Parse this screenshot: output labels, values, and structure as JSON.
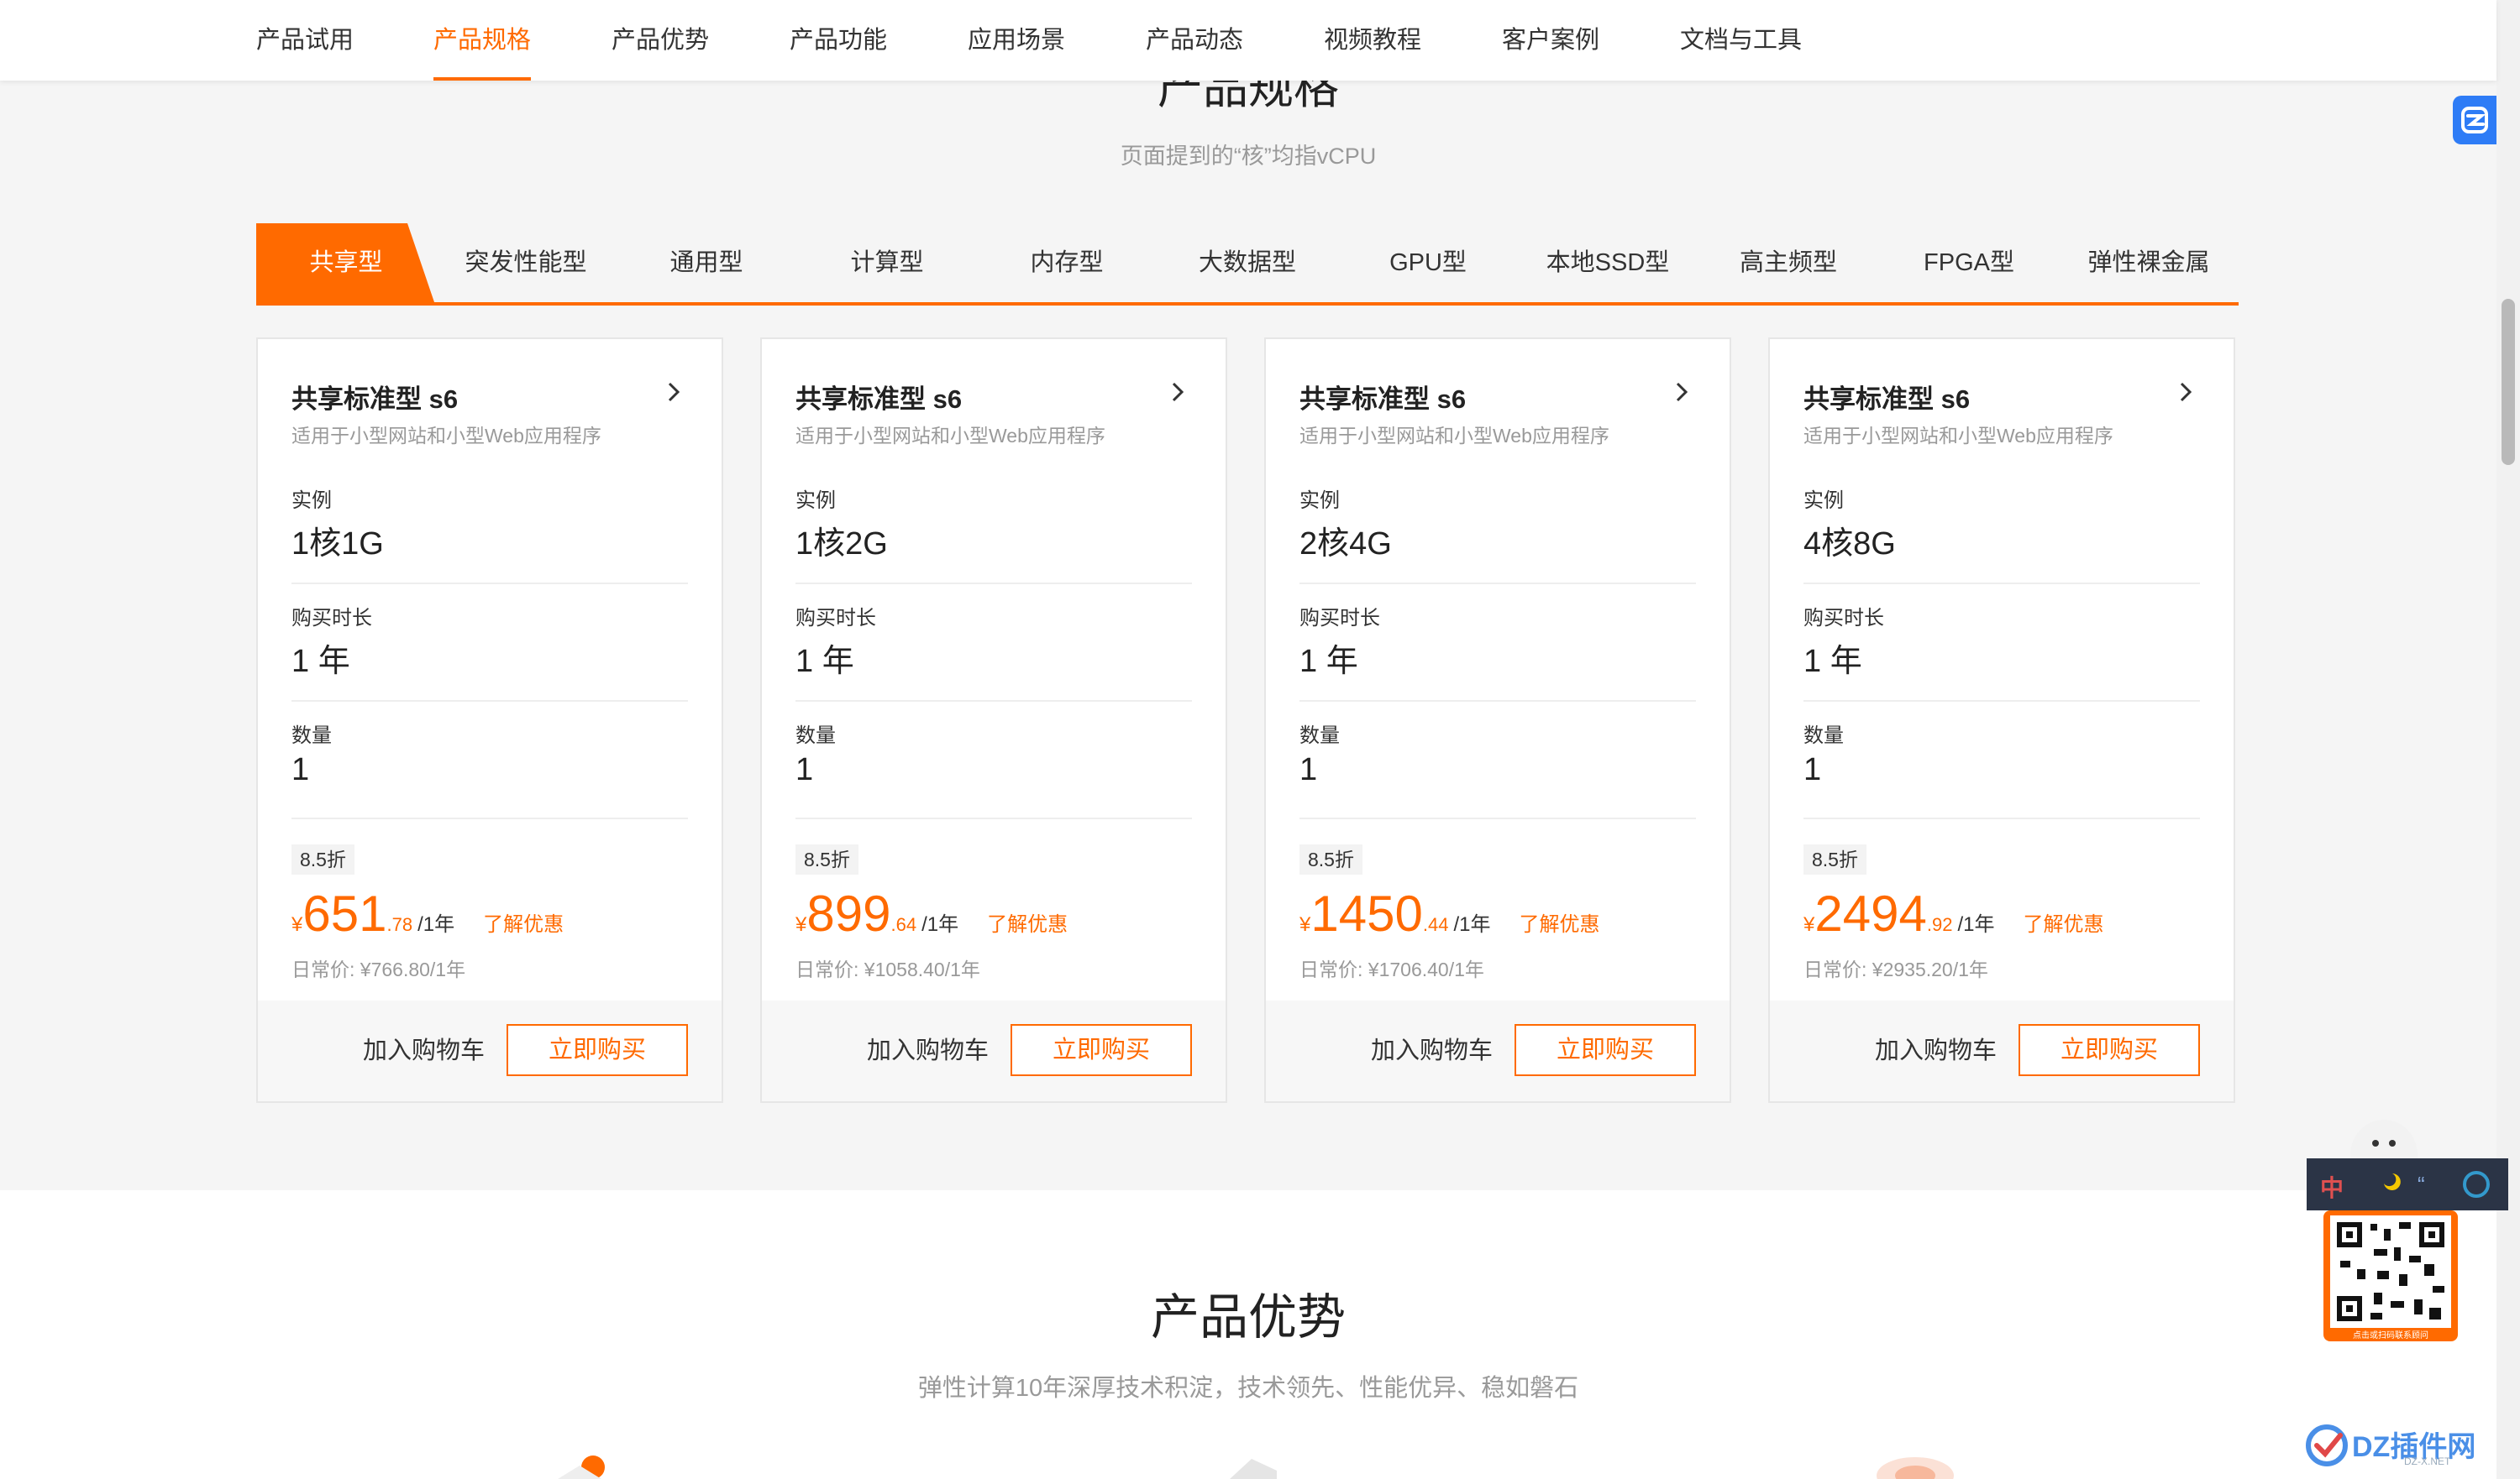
{
  "nav": {
    "items": [
      "产品试用",
      "产品规格",
      "产品优势",
      "产品功能",
      "应用场景",
      "产品动态",
      "视频教程",
      "客户案例",
      "文档与工具"
    ],
    "active_index": 1
  },
  "spec": {
    "title": "产品规格",
    "subtitle": "页面提到的“核”均指vCPU",
    "tabs": [
      "共享型",
      "突发性能型",
      "通用型",
      "计算型",
      "内存型",
      "大数据型",
      "GPU型",
      "本地SSD型",
      "高主频型",
      "FPGA型",
      "弹性裸金属"
    ],
    "active_tab": 0,
    "cards": [
      {
        "title": "共享标准型 s6",
        "desc": "适用于小型网站和小型Web应用程序",
        "instance_label": "实例",
        "instance": "1核1G",
        "duration_label": "购买时长",
        "duration": "1 年",
        "qty_label": "数量",
        "qty": "1",
        "discount": "8.5折",
        "yen": "¥",
        "price_int": "651",
        "price_dec": ".78",
        "per": "/1年",
        "promo": "了解优惠",
        "orig": "日常价: ¥766.80/1年",
        "cart": "加入购物车",
        "buy": "立即购买"
      },
      {
        "title": "共享标准型 s6",
        "desc": "适用于小型网站和小型Web应用程序",
        "instance_label": "实例",
        "instance": "1核2G",
        "duration_label": "购买时长",
        "duration": "1 年",
        "qty_label": "数量",
        "qty": "1",
        "discount": "8.5折",
        "yen": "¥",
        "price_int": "899",
        "price_dec": ".64",
        "per": "/1年",
        "promo": "了解优惠",
        "orig": "日常价: ¥1058.40/1年",
        "cart": "加入购物车",
        "buy": "立即购买"
      },
      {
        "title": "共享标准型 s6",
        "desc": "适用于小型网站和小型Web应用程序",
        "instance_label": "实例",
        "instance": "2核4G",
        "duration_label": "购买时长",
        "duration": "1 年",
        "qty_label": "数量",
        "qty": "1",
        "discount": "8.5折",
        "yen": "¥",
        "price_int": "1450",
        "price_dec": ".44",
        "per": "/1年",
        "promo": "了解优惠",
        "orig": "日常价: ¥1706.40/1年",
        "cart": "加入购物车",
        "buy": "立即购买"
      },
      {
        "title": "共享标准型 s6",
        "desc": "适用于小型网站和小型Web应用程序",
        "instance_label": "实例",
        "instance": "4核8G",
        "duration_label": "购买时长",
        "duration": "1 年",
        "qty_label": "数量",
        "qty": "1",
        "discount": "8.5折",
        "yen": "¥",
        "price_int": "2494",
        "price_dec": ".92",
        "per": "/1年",
        "promo": "了解优惠",
        "orig": "日常价: ¥2935.20/1年",
        "cart": "加入购物车",
        "buy": "立即购买"
      }
    ]
  },
  "advantages": {
    "title": "产品优势",
    "subtitle": "弹性计算10年深厚技术积淀，技术领先、性能优异、稳如磐石"
  },
  "widget": {
    "toolbar_char": "中",
    "qr_caption": "点击或扫码联系顾问"
  },
  "watermark": {
    "text": "DZ插件网",
    "sub": "DZ-X.NET"
  },
  "colors": {
    "accent": "#ff6a00",
    "float_button": "#2e7cf6",
    "widget_bar": "#2b3446"
  },
  "icons": {
    "card_link": "chevron-right-icon",
    "float": "sidebar-toggle-icon",
    "mascot": "robot-mascot-icon",
    "moon": "moon-icon",
    "quote": "quote-icon",
    "settings": "settings-icon",
    "qr": "qr-code-icon",
    "watermark_logo": "check-circle-logo-icon"
  }
}
